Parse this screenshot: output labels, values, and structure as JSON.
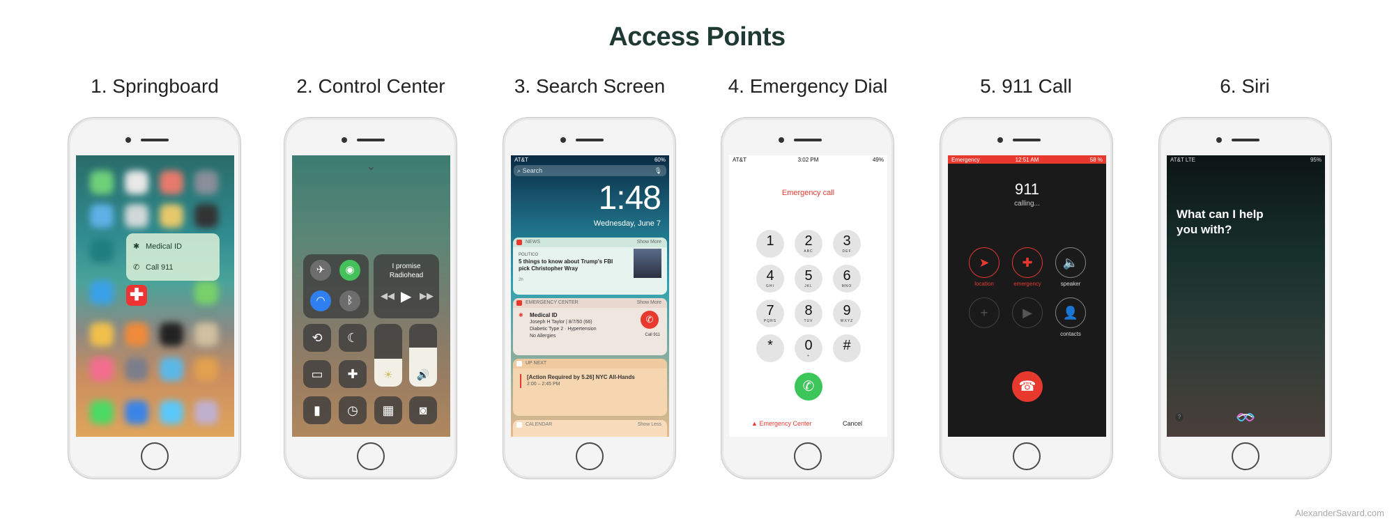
{
  "title": "Access Points",
  "credit": "AlexanderSavard.com",
  "steps": [
    {
      "label": "1. Springboard"
    },
    {
      "label": "2. Control Center"
    },
    {
      "label": "3. Search Screen"
    },
    {
      "label": "4. Emergency Dial"
    },
    {
      "label": "5. 911 Call"
    },
    {
      "label": "6. Siri"
    }
  ],
  "springboard": {
    "menu_items": [
      {
        "icon": "asterisk-icon",
        "label": "Medical ID"
      },
      {
        "icon": "phone-icon",
        "label": "Call 911"
      }
    ],
    "app_icon": "medical-cross-icon"
  },
  "control_center": {
    "music_title": "I promise",
    "music_artist": "Radiohead",
    "brightness_level": 0.45,
    "volume_level": 0.62
  },
  "search": {
    "carrier": "AT&T",
    "battery": "60%",
    "placeholder": "Search",
    "time": "1:48",
    "date": "Wednesday, June 7",
    "news": {
      "header": "NEWS",
      "show_more": "Show More",
      "source": "POLITICO",
      "headline": "5 things to know about Trump's FBI pick Christopher Wray",
      "age": "2h"
    },
    "emergency": {
      "header": "EMERGENCY CENTER",
      "show_more": "Show More",
      "title": "Medical ID",
      "line1": "Joseph H Taylor  |  8/7/50 (66)",
      "line2": "Diabetic Type 2 · Hypertension",
      "line3": "No Allergies",
      "call_label": "Call 911"
    },
    "upnext": {
      "header": "UP NEXT",
      "event": "[Action Required by 5.26] NYC All-Hands",
      "time": "2:00 – 2:45 PM"
    },
    "calendar": {
      "header": "CALENDAR",
      "show_less": "Show Less"
    }
  },
  "dial": {
    "carrier": "AT&T",
    "time": "3:02 PM",
    "battery": "49%",
    "heading": "Emergency call",
    "keys": [
      {
        "d": "1",
        "l": ""
      },
      {
        "d": "2",
        "l": "ABC"
      },
      {
        "d": "3",
        "l": "DEF"
      },
      {
        "d": "4",
        "l": "GHI"
      },
      {
        "d": "5",
        "l": "JKL"
      },
      {
        "d": "6",
        "l": "MNO"
      },
      {
        "d": "7",
        "l": "PQRS"
      },
      {
        "d": "8",
        "l": "TUV"
      },
      {
        "d": "9",
        "l": "WXYZ"
      },
      {
        "d": "*",
        "l": ""
      },
      {
        "d": "0",
        "l": "+"
      },
      {
        "d": "#",
        "l": ""
      }
    ],
    "emergency_center": "Emergency Center",
    "cancel": "Cancel"
  },
  "call": {
    "status_left": "Emergency",
    "time": "12:51 AM",
    "battery": "58 %",
    "number": "911",
    "state": "calling...",
    "buttons": [
      {
        "label": "location",
        "icon": "location-arrow-icon",
        "active": true
      },
      {
        "label": "emergency",
        "icon": "medical-cross-icon",
        "active": true
      },
      {
        "label": "speaker",
        "icon": "speaker-icon",
        "active": false
      },
      {
        "label": "",
        "icon": "plus-icon",
        "active": false
      },
      {
        "label": "",
        "icon": "facetime-icon",
        "active": false
      },
      {
        "label": "contacts",
        "icon": "contacts-icon",
        "active": false
      }
    ]
  },
  "siri": {
    "carrier": "AT&T  LTE",
    "battery": "95%",
    "prompt": "What can I help you with?",
    "help": "?"
  },
  "colors": {
    "accent_red": "#e8392f",
    "call_green": "#3cc65a",
    "title": "#1f3a33"
  }
}
